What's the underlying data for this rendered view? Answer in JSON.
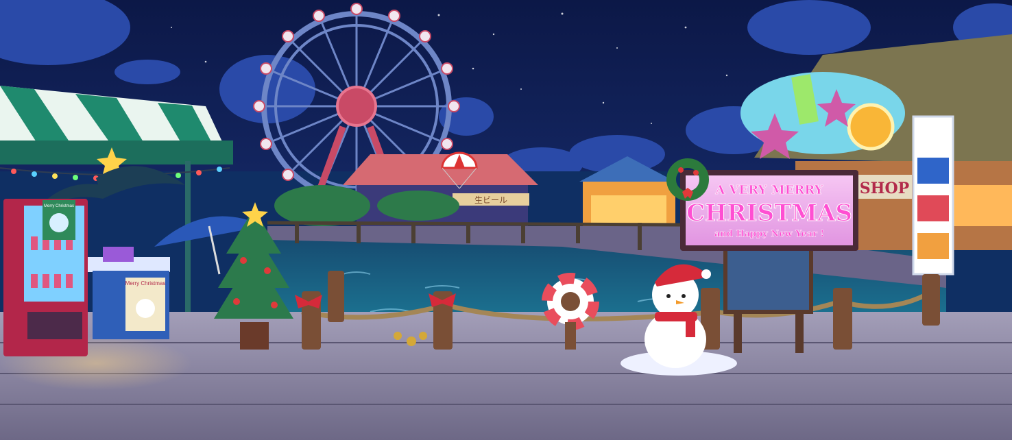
{
  "sign": {
    "line1": "A VERY MERRY",
    "line2": "CHRISTMAS",
    "line3": "and Happy New Year !"
  },
  "shop_sign": "SHOP",
  "pavilion_sign": "生ビール",
  "vending_poster": "Merry Christmas",
  "cooler_label": "Merry Christmas",
  "colors": {
    "sky_top": "#0c1847",
    "sky_bottom": "#1e3a86",
    "sign_pink": "#e8a6e6",
    "sign_text": "#ff4fd2",
    "awning_green": "#1f8a6e",
    "deck": "#8f8aa6",
    "water": "#1c5f86"
  },
  "icons": [
    "ferris-wheel-icon",
    "christmas-tree-icon",
    "snowman-icon",
    "star-icon",
    "wreath-icon",
    "parachute-icon",
    "life-ring-icon",
    "vending-machine-icon"
  ]
}
